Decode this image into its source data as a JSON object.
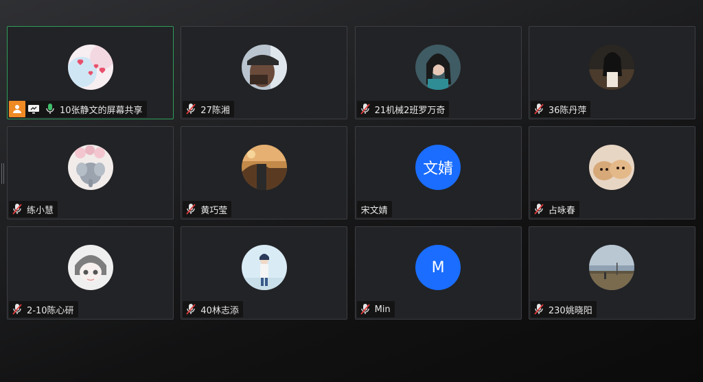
{
  "participants": [
    {
      "name": "10张静文的屏幕共享",
      "avatar": "pink-hearts-avatar",
      "mic": "on",
      "host": true,
      "screen_share": true,
      "active": true
    },
    {
      "name": "27陈湘",
      "avatar": "photo-avatar-cap",
      "mic": "muted"
    },
    {
      "name": "21机械2班罗万奇",
      "avatar": "photo-avatar-girl",
      "mic": "muted"
    },
    {
      "name": "36陈丹萍",
      "avatar": "photo-avatar-dark",
      "mic": "muted"
    },
    {
      "name": "练小慧",
      "avatar": "cartoon-elephant-avatar",
      "mic": "muted"
    },
    {
      "name": "黄巧莹",
      "avatar": "photo-avatar-sunset",
      "mic": "muted"
    },
    {
      "name": "宋文婧",
      "avatar_initials": "文婧",
      "mic": "none"
    },
    {
      "name": "占咏春",
      "avatar": "puppies-avatar",
      "mic": "muted"
    },
    {
      "name": "2-10陈心研",
      "avatar": "anime-sketch-avatar",
      "mic": "muted"
    },
    {
      "name": "40林志添",
      "avatar": "anime-boy-avatar",
      "mic": "muted"
    },
    {
      "name": "Min",
      "avatar_initials": "M",
      "mic": "muted"
    },
    {
      "name": "230姚晓阳",
      "avatar": "landscape-avatar",
      "mic": "muted"
    }
  ],
  "colors": {
    "tile_bg": "#222326",
    "active_border": "#2e9e5b",
    "initials_bg": "#1a6dff",
    "host_badge": "#f08a24",
    "mic_on": "#3fbf6a",
    "mic_muted_slash": "#e03a3a"
  }
}
